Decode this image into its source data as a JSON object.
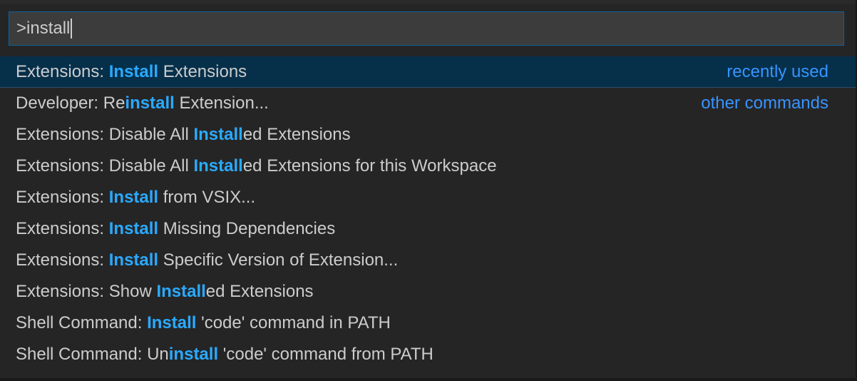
{
  "input": {
    "value": ">install"
  },
  "items": [
    {
      "before": "Extensions: ",
      "match": "Install",
      "after": " Extensions",
      "tag": "recently used",
      "selected": true
    },
    {
      "before": "Developer: Re",
      "match": "install",
      "after": " Extension...",
      "tag": "other commands",
      "selected": false
    },
    {
      "before": "Extensions: Disable All ",
      "match": "Install",
      "after": "ed Extensions",
      "tag": "",
      "selected": false
    },
    {
      "before": "Extensions: Disable All ",
      "match": "Install",
      "after": "ed Extensions for this Workspace",
      "tag": "",
      "selected": false
    },
    {
      "before": "Extensions: ",
      "match": "Install",
      "after": " from VSIX...",
      "tag": "",
      "selected": false
    },
    {
      "before": "Extensions: ",
      "match": "Install",
      "after": " Missing Dependencies",
      "tag": "",
      "selected": false
    },
    {
      "before": "Extensions: ",
      "match": "Install",
      "after": " Specific Version of Extension...",
      "tag": "",
      "selected": false
    },
    {
      "before": "Extensions: Show ",
      "match": "Install",
      "after": "ed Extensions",
      "tag": "",
      "selected": false
    },
    {
      "before": "Shell Command: ",
      "match": "Install",
      "after": " 'code' command in PATH",
      "tag": "",
      "selected": false
    },
    {
      "before": "Shell Command: Un",
      "match": "install",
      "after": " 'code' command from PATH",
      "tag": "",
      "selected": false
    }
  ],
  "colors": {
    "highlight": "#2aaaff",
    "selected_bg": "#062f4a",
    "tag": "#3794ff",
    "input_border": "#0e639c"
  }
}
